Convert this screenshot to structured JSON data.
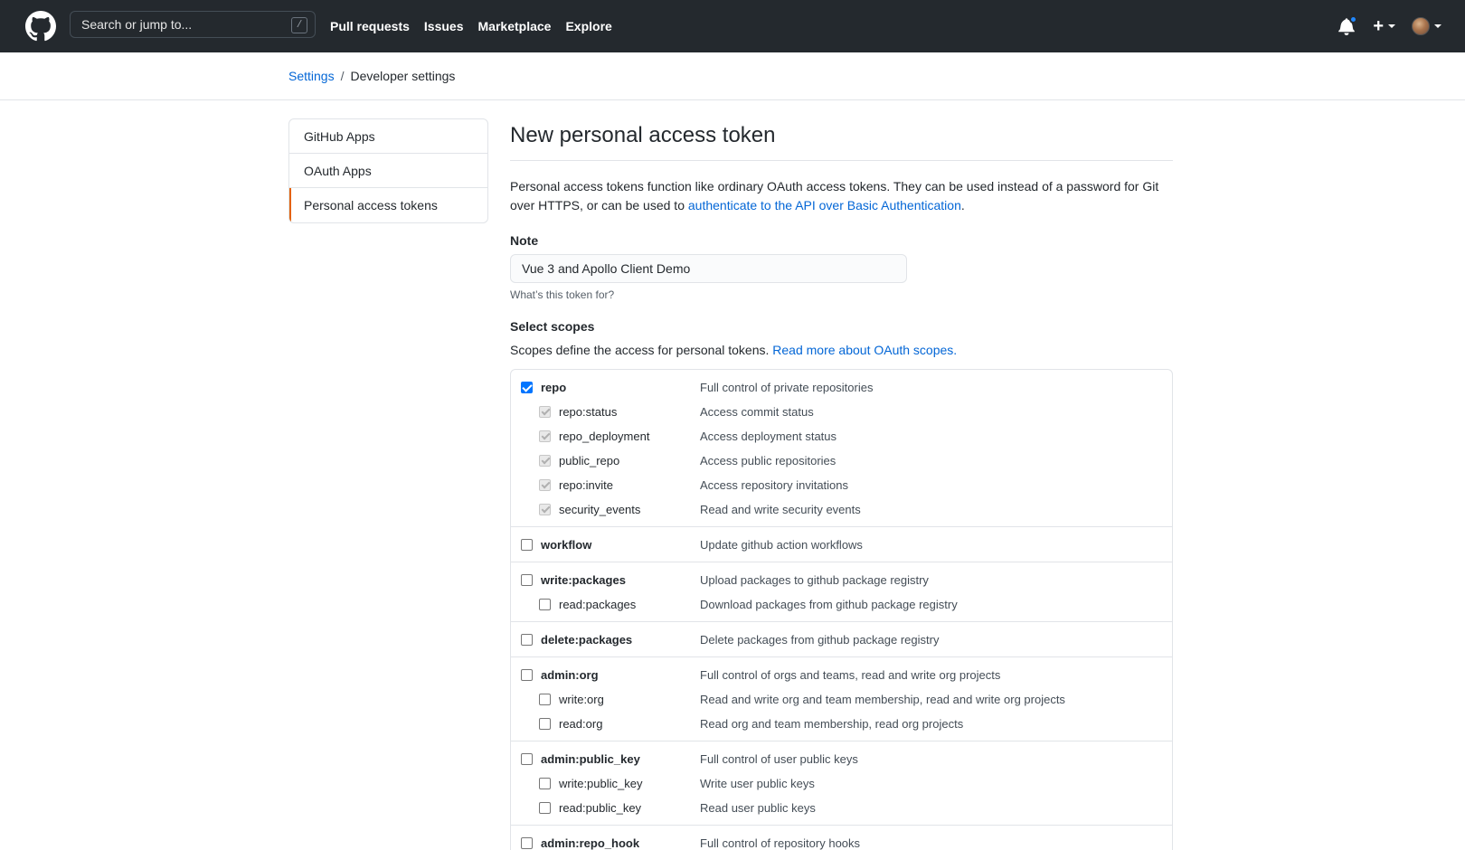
{
  "header": {
    "search_placeholder": "Search or jump to...",
    "search_shortcut": "/",
    "nav": [
      "Pull requests",
      "Issues",
      "Marketplace",
      "Explore"
    ],
    "plus_symbol": "+",
    "notification_dot_color": "#2188ff"
  },
  "breadcrumb": {
    "parent": "Settings",
    "separator": "/",
    "current": "Developer settings"
  },
  "sidebar": {
    "items": [
      {
        "label": "GitHub Apps"
      },
      {
        "label": "OAuth Apps"
      },
      {
        "label": "Personal access tokens",
        "selected": true
      }
    ]
  },
  "main": {
    "title": "New personal access token",
    "intro_text": "Personal access tokens function like ordinary OAuth access tokens. They can be used instead of a password for Git over HTTPS, or can be used to ",
    "intro_link": "authenticate to the API over Basic Authentication",
    "intro_end": ".",
    "note_label": "Note",
    "note_value": "Vue 3 and Apollo Client Demo",
    "note_hint": "What’s this token for?",
    "scopes_label": "Select scopes",
    "scopes_desc": "Scopes define the access for personal tokens. ",
    "scopes_link": "Read more about OAuth scopes.",
    "scope_groups": [
      {
        "name": "repo",
        "desc": "Full control of private repositories",
        "checked": true,
        "children": [
          {
            "name": "repo:status",
            "desc": "Access commit status",
            "checked": true,
            "disabled": true
          },
          {
            "name": "repo_deployment",
            "desc": "Access deployment status",
            "checked": true,
            "disabled": true
          },
          {
            "name": "public_repo",
            "desc": "Access public repositories",
            "checked": true,
            "disabled": true
          },
          {
            "name": "repo:invite",
            "desc": "Access repository invitations",
            "checked": true,
            "disabled": true
          },
          {
            "name": "security_events",
            "desc": "Read and write security events",
            "checked": true,
            "disabled": true
          }
        ]
      },
      {
        "name": "workflow",
        "desc": "Update github action workflows",
        "checked": false,
        "children": []
      },
      {
        "name": "write:packages",
        "desc": "Upload packages to github package registry",
        "checked": false,
        "children": [
          {
            "name": "read:packages",
            "desc": "Download packages from github package registry",
            "checked": false
          }
        ]
      },
      {
        "name": "delete:packages",
        "desc": "Delete packages from github package registry",
        "checked": false,
        "children": []
      },
      {
        "name": "admin:org",
        "desc": "Full control of orgs and teams, read and write org projects",
        "checked": false,
        "children": [
          {
            "name": "write:org",
            "desc": "Read and write org and team membership, read and write org projects",
            "checked": false
          },
          {
            "name": "read:org",
            "desc": "Read org and team membership, read org projects",
            "checked": false
          }
        ]
      },
      {
        "name": "admin:public_key",
        "desc": "Full control of user public keys",
        "checked": false,
        "children": [
          {
            "name": "write:public_key",
            "desc": "Write user public keys",
            "checked": false
          },
          {
            "name": "read:public_key",
            "desc": "Read user public keys",
            "checked": false
          }
        ]
      },
      {
        "name": "admin:repo_hook",
        "desc": "Full control of repository hooks",
        "checked": false,
        "children": []
      }
    ]
  }
}
